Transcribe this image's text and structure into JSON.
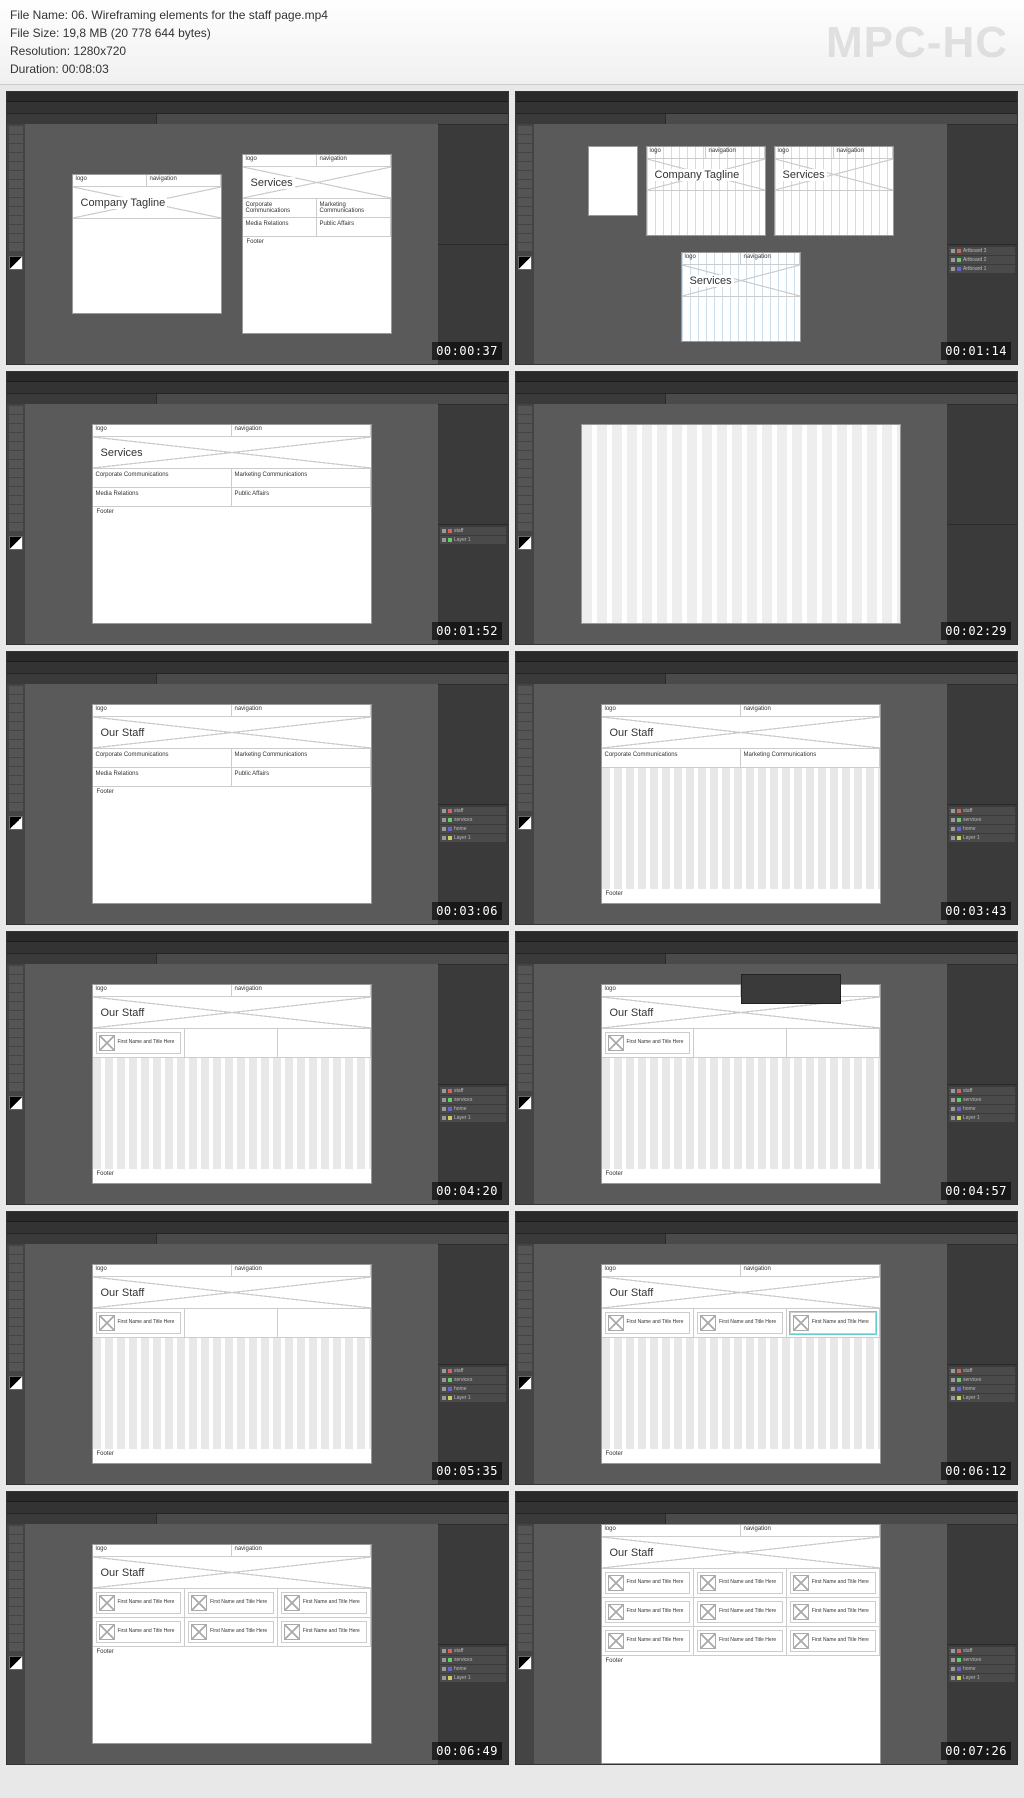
{
  "header": {
    "filename_label": "File Name:",
    "filename": "06. Wireframing elements for the staff page.mp4",
    "filesize_label": "File Size:",
    "filesize": "19,8 MB (20 778 644 bytes)",
    "resolution_label": "Resolution:",
    "resolution": "1280x720",
    "duration_label": "Duration:",
    "duration": "00:08:03",
    "watermark": "MPC-HC"
  },
  "thumbs": [
    {
      "ts": "00:00:37",
      "artboards": [
        {
          "title": "Company Tagline",
          "sections": []
        },
        {
          "title": "Services",
          "sections": [
            "Corporate Communications",
            "Marketing Communications",
            "Media Relations",
            "Public Affairs"
          ],
          "footer": "Footer"
        }
      ]
    },
    {
      "ts": "00:01:14",
      "artboards": [
        {
          "title": "Company Tagline",
          "grid": true
        },
        {
          "title": "Services",
          "grid": true
        },
        {
          "title": "Services",
          "grid": true
        }
      ],
      "layers": [
        "Artboard 3",
        "Artboard 2",
        "Artboard 1"
      ]
    },
    {
      "ts": "00:01:52",
      "artboards": [
        {
          "title": "Services",
          "sections": [
            "Corporate Communications",
            "Marketing Communications",
            "Media Relations",
            "Public Affairs"
          ],
          "footer": "Footer"
        }
      ],
      "layers": [
        "staff",
        "Layer 1"
      ]
    },
    {
      "ts": "00:02:29",
      "artboards": [
        {
          "blank_stripes": true
        }
      ]
    },
    {
      "ts": "00:03:06",
      "artboards": [
        {
          "title": "Our Staff",
          "sections": [
            "Corporate Communications",
            "Marketing Communications",
            "Media Relations",
            "Public Affairs"
          ],
          "footer": "Footer"
        }
      ],
      "layers": [
        "staff",
        "services",
        "home",
        "Layer 1"
      ]
    },
    {
      "ts": "00:03:43",
      "artboards": [
        {
          "title": "Our Staff",
          "sections": [
            "Corporate Communications",
            "Marketing Communications"
          ],
          "stripes": true,
          "footer": "Footer"
        }
      ],
      "layers": [
        "staff",
        "services",
        "home",
        "Layer 1"
      ]
    },
    {
      "ts": "00:04:20",
      "artboards": [
        {
          "title": "Our Staff",
          "staff_row": [
            {
              "name": "First Name and Title Here"
            }
          ],
          "stripes": true,
          "footer": "Footer"
        }
      ],
      "layers": [
        "staff",
        "services",
        "home",
        "Layer 1"
      ]
    },
    {
      "ts": "00:04:57",
      "artboards": [
        {
          "title": "Our Staff",
          "staff_row": [
            {
              "name": "First Name and Title Here"
            }
          ],
          "stripes": true,
          "footer": "Footer"
        }
      ],
      "layers": [
        "staff",
        "services",
        "home",
        "Layer 1"
      ],
      "popup": true
    },
    {
      "ts": "00:05:35",
      "artboards": [
        {
          "title": "Our Staff",
          "staff_row": [
            {
              "name": "First Name and Title Here"
            }
          ],
          "stripes": true,
          "footer": "Footer"
        }
      ],
      "layers": [
        "staff",
        "services",
        "home",
        "Layer 1"
      ]
    },
    {
      "ts": "00:06:12",
      "artboards": [
        {
          "title": "Our Staff",
          "staff_row": [
            {
              "name": "First Name and Title Here"
            },
            {
              "name": "First Name and Title Here"
            },
            {
              "name": "First Name and Title Here"
            }
          ],
          "stripes": true,
          "footer": "Footer"
        }
      ],
      "layers": [
        "staff",
        "services",
        "home",
        "Layer 1"
      ]
    },
    {
      "ts": "00:06:49",
      "artboards": [
        {
          "title": "Our Staff",
          "staff_rows": 2,
          "footer": "Footer"
        }
      ],
      "layers": [
        "staff",
        "services",
        "home",
        "Layer 1"
      ]
    },
    {
      "ts": "00:07:26",
      "artboards": [
        {
          "title": "Our Staff",
          "staff_rows": 3,
          "footer": "Footer"
        }
      ],
      "layers": [
        "staff",
        "services",
        "home",
        "Layer 1"
      ]
    }
  ],
  "staff_name": "First Name and Title Here",
  "labels": {
    "nav1": "logo",
    "nav2": "navigation"
  }
}
